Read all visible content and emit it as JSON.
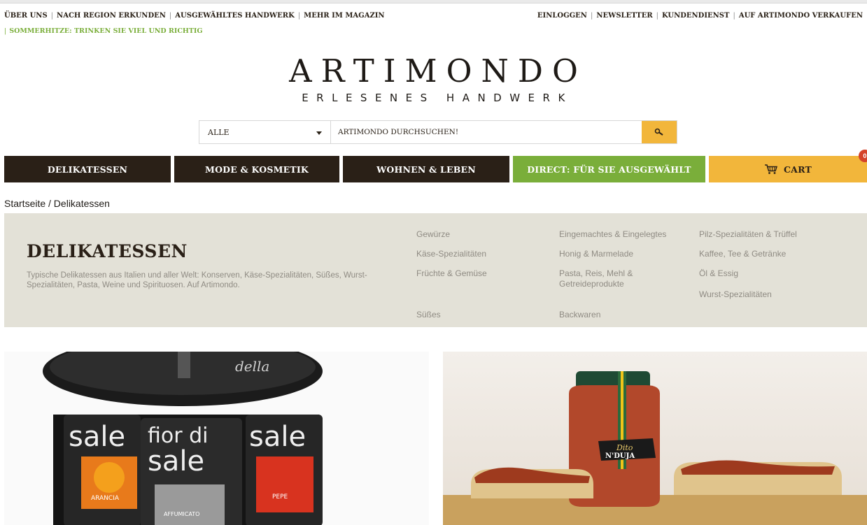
{
  "utility_nav": {
    "left": [
      "ÜBER UNS",
      "NACH REGION ERKUNDEN",
      "AUSGEWÄHLTES HANDWERK",
      "MEHR IM MAGAZIN"
    ],
    "right": [
      "EINLOGGEN",
      "NEWSLETTER",
      "KUNDENDIENST",
      "AUF ARTIMONDO VERKAUFEN"
    ]
  },
  "promo": "SOMMERHITZE: TRINKEN SIE VIEL UND RICHTIG",
  "logo": {
    "name": "ARTIMONDO",
    "tagline": "ERLESENES HANDWERK"
  },
  "search": {
    "category": "ALLE",
    "placeholder": "ARTIMONDO DURCHSUCHEN!",
    "button_icon": "search-icon"
  },
  "main_nav": {
    "items": [
      "DELIKATESSEN",
      "MODE & KOSMETIK",
      "WOHNEN & LEBEN",
      "DIRECT: FÜR SIE AUSGEWÄHLT"
    ],
    "cart_label": "CART",
    "cart_count": "0"
  },
  "breadcrumb": "Startseite / Delikatessen",
  "category": {
    "title": "DELIKATESSEN",
    "description": "Typische Delikatessen aus Italien und aller Welt: Konserven, Käse-Spezialitäten, Süßes, Wurst-Spezialitäten, Pasta, Weine und Spirituosen. Auf Artimondo.",
    "links": [
      "Gewürze",
      "Käse-Spezialitäten",
      "Früchte & Gemüse",
      "Süßes",
      "Eingemachtes & Eingelegtes",
      "Honig & Marmelade",
      "Pasta, Reis, Mehl & Getreideprodukte",
      "Backwaren",
      "Pilz-Spezialitäten & Trüffel",
      "Kaffee, Tee & Getränke",
      "Öl & Essig",
      "Wurst-Spezialitäten"
    ]
  },
  "tiles": {
    "left": {
      "jar_texts": [
        "sale",
        "fior di",
        "sale",
        "ARANCIA",
        "PEPE",
        "AFFUMICATO",
        "della"
      ]
    },
    "right": {
      "label_brand": "Dito",
      "label_product": "N'DUJA"
    }
  },
  "colors": {
    "dark": "#2a2017",
    "green": "#7aae3a",
    "yellow": "#f2b63b",
    "panel": "#e3e1d7",
    "badge": "#d5432a"
  }
}
